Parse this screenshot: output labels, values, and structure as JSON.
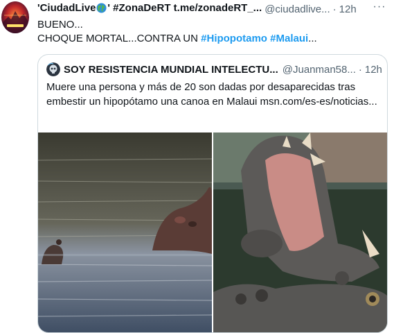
{
  "tweet": {
    "author_name_part1": "'CiudadLive",
    "author_name_part2": "' #ZonaDeRT t.me/zonadeRT_...",
    "handle": "@ciudadlive...",
    "separator": "·",
    "time": "12h",
    "more_label": "···",
    "avatar_icon": "ciudadlive-logo",
    "text_line1": "BUENO...",
    "text_line2_prefix": "CHOQUE MORTAL...CONTRA UN ",
    "hashtag1": "#Hipopotamo",
    "hashtag2": "#Malaui",
    "text_line2_suffix": "..."
  },
  "quote": {
    "author_name": "SOY RESISTENCIA MUNDIAL INTELECTU...",
    "handle": "@Juanman58...",
    "separator": "·",
    "time": "12h",
    "text": "Muere una persona y más de 20 son dadas por desaparecidas tras embestir un hipopótamo una canoa en Malaui msn.com/es-es/noticias...",
    "images": [
      "hippo-in-river-photo",
      "hippo-open-mouth-photo"
    ]
  },
  "colors": {
    "link": "#1d9bf0",
    "secondary_text": "#536471",
    "border": "#cfd9de"
  }
}
